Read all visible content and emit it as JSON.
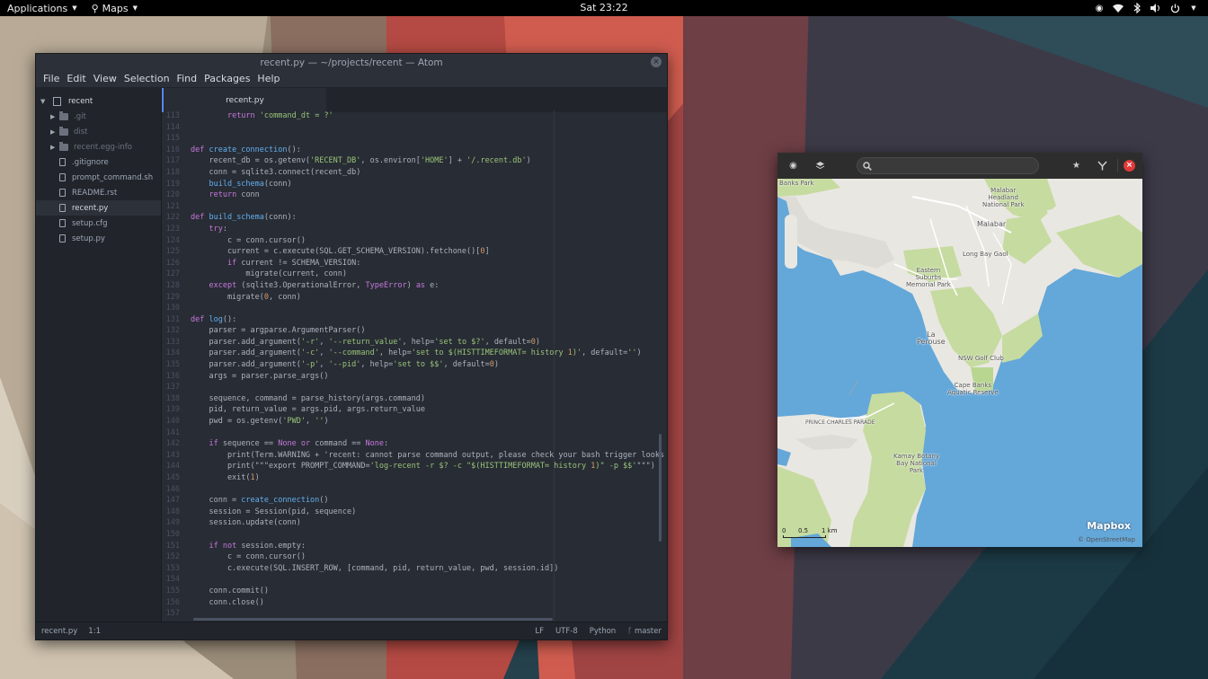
{
  "topbar": {
    "applications": "Applications",
    "maps_menu": "Maps",
    "clock": "Sat 23:22"
  },
  "atom": {
    "title": "recent.py — ~/projects/recent — Atom",
    "menu": [
      "File",
      "Edit",
      "View",
      "Selection",
      "Find",
      "Packages",
      "Help"
    ],
    "tab": "recent.py",
    "tree": {
      "root": "recent",
      "items": [
        {
          "label": ".git",
          "type": "dir"
        },
        {
          "label": "dist",
          "type": "dir"
        },
        {
          "label": "recent.egg-info",
          "type": "dir"
        },
        {
          "label": ".gitignore",
          "type": "file"
        },
        {
          "label": "prompt_command.sh",
          "type": "file"
        },
        {
          "label": "README.rst",
          "type": "file"
        },
        {
          "label": "recent.py",
          "type": "file"
        },
        {
          "label": "setup.cfg",
          "type": "file"
        },
        {
          "label": "setup.py",
          "type": "file"
        }
      ]
    },
    "code": [
      {
        "n": "113",
        "t": "        return 'command_dt = ?'"
      },
      {
        "n": "114",
        "t": ""
      },
      {
        "n": "115",
        "t": ""
      },
      {
        "n": "116",
        "t": "def create_connection():"
      },
      {
        "n": "117",
        "t": "    recent_db = os.getenv('RECENT_DB', os.environ['HOME'] + '/.recent.db')"
      },
      {
        "n": "118",
        "t": "    conn = sqlite3.connect(recent_db)"
      },
      {
        "n": "119",
        "t": "    build_schema(conn)"
      },
      {
        "n": "120",
        "t": "    return conn"
      },
      {
        "n": "121",
        "t": ""
      },
      {
        "n": "122",
        "t": "def build_schema(conn):"
      },
      {
        "n": "123",
        "t": "    try:"
      },
      {
        "n": "124",
        "t": "        c = conn.cursor()"
      },
      {
        "n": "125",
        "t": "        current = c.execute(SQL.GET_SCHEMA_VERSION).fetchone()[0]"
      },
      {
        "n": "126",
        "t": "        if current != SCHEMA_VERSION:"
      },
      {
        "n": "127",
        "t": "            migrate(current, conn)"
      },
      {
        "n": "128",
        "t": "    except (sqlite3.OperationalError, TypeError) as e:"
      },
      {
        "n": "129",
        "t": "        migrate(0, conn)"
      },
      {
        "n": "130",
        "t": ""
      },
      {
        "n": "131",
        "t": "def log():"
      },
      {
        "n": "132",
        "t": "    parser = argparse.ArgumentParser()"
      },
      {
        "n": "133",
        "t": "    parser.add_argument('-r', '--return_value', help='set to $?', default=0)"
      },
      {
        "n": "134",
        "t": "    parser.add_argument('-c', '--command', help='set to $(HISTTIMEFORMAT= history 1)', default='')"
      },
      {
        "n": "135",
        "t": "    parser.add_argument('-p', '--pid', help='set to $$', default=0)"
      },
      {
        "n": "136",
        "t": "    args = parser.parse_args()"
      },
      {
        "n": "137",
        "t": ""
      },
      {
        "n": "138",
        "t": "    sequence, command = parse_history(args.command)"
      },
      {
        "n": "139",
        "t": "    pid, return_value = args.pid, args.return_value"
      },
      {
        "n": "140",
        "t": "    pwd = os.getenv('PWD', '')"
      },
      {
        "n": "141",
        "t": ""
      },
      {
        "n": "142",
        "t": "    if sequence == None or command == None:"
      },
      {
        "n": "143",
        "t": "        print(Term.WARNING + 'recent: cannot parse command output, please check your bash trigger looks"
      },
      {
        "n": "144",
        "t": "        print(\"\"\"export PROMPT_COMMAND='log-recent -r $? -c \"$(HISTTIMEFORMAT= history 1)\" -p $$'\"\"\")"
      },
      {
        "n": "145",
        "t": "        exit(1)"
      },
      {
        "n": "146",
        "t": ""
      },
      {
        "n": "147",
        "t": "    conn = create_connection()"
      },
      {
        "n": "148",
        "t": "    session = Session(pid, sequence)"
      },
      {
        "n": "149",
        "t": "    session.update(conn)"
      },
      {
        "n": "150",
        "t": ""
      },
      {
        "n": "151",
        "t": "    if not session.empty:"
      },
      {
        "n": "152",
        "t": "        c = conn.cursor()"
      },
      {
        "n": "153",
        "t": "        c.execute(SQL.INSERT_ROW, [command, pid, return_value, pwd, session.id])"
      },
      {
        "n": "154",
        "t": ""
      },
      {
        "n": "155",
        "t": "    conn.commit()"
      },
      {
        "n": "156",
        "t": "    conn.close()"
      },
      {
        "n": "157",
        "t": ""
      }
    ],
    "status": {
      "file": "recent.py",
      "cursor": "1:1",
      "line_ending": "LF",
      "encoding": "UTF-8",
      "grammar": "Python",
      "branch": "master"
    }
  },
  "maps": {
    "search_placeholder": "",
    "attribution_logo": "Mapbox",
    "attribution_text": "© OpenStreetMap",
    "scale": {
      "s0": "0",
      "s1": "0.5",
      "s2": "1 km"
    },
    "labels": [
      {
        "id": "banks-park",
        "text": "Banks Park"
      },
      {
        "id": "malabar-headland",
        "text": "Malabar\nHeadland\nNational Park"
      },
      {
        "id": "malabar",
        "text": "Malabar"
      },
      {
        "id": "long-bay-gaol",
        "text": "Long Bay Gaol"
      },
      {
        "id": "eastern-suburbs",
        "text": "Eastern\nSuburbs\nMemorial Park"
      },
      {
        "id": "la-perouse",
        "text": "La\nPerouse"
      },
      {
        "id": "nsw-golf",
        "text": "NSW Golf Club"
      },
      {
        "id": "cape-banks",
        "text": "Cape Banks\nAquatic Reserve"
      },
      {
        "id": "prince-charles",
        "text": "PRINCE CHARLES PARADE"
      },
      {
        "id": "kamay",
        "text": "Kamay Botany\nBay National\nPark"
      }
    ],
    "colors": {
      "water": "#64a7d9",
      "land": "#e9e7e2",
      "park": "#c6dba0"
    }
  }
}
